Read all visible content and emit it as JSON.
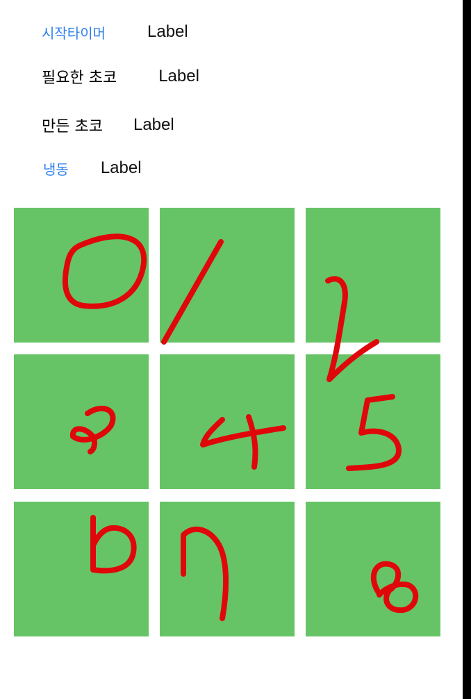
{
  "rows": [
    {
      "name": "start-timer",
      "label": "시작타이머",
      "value": "Label",
      "is_link": true
    },
    {
      "name": "needed-chocolate",
      "label": "필요한 초코",
      "value": "Label",
      "is_link": false
    },
    {
      "name": "made-chocolate",
      "label": "만든 초코",
      "value": "Label",
      "is_link": false
    },
    {
      "name": "freeze",
      "label": "냉동",
      "value": "Label",
      "is_link": true
    }
  ],
  "grid": {
    "rows": 3,
    "columns": 3,
    "tile_color": "#66c466",
    "tile_count": 9
  },
  "overlay": {
    "digits": [
      "0",
      "1",
      "2",
      "3",
      "4",
      "5",
      "6",
      "7",
      "8"
    ],
    "stroke_color": "#e0070b"
  },
  "colors": {
    "link": "#2f80ed",
    "text": "#000000",
    "background": "#ffffff",
    "right_bar": "#000000"
  }
}
